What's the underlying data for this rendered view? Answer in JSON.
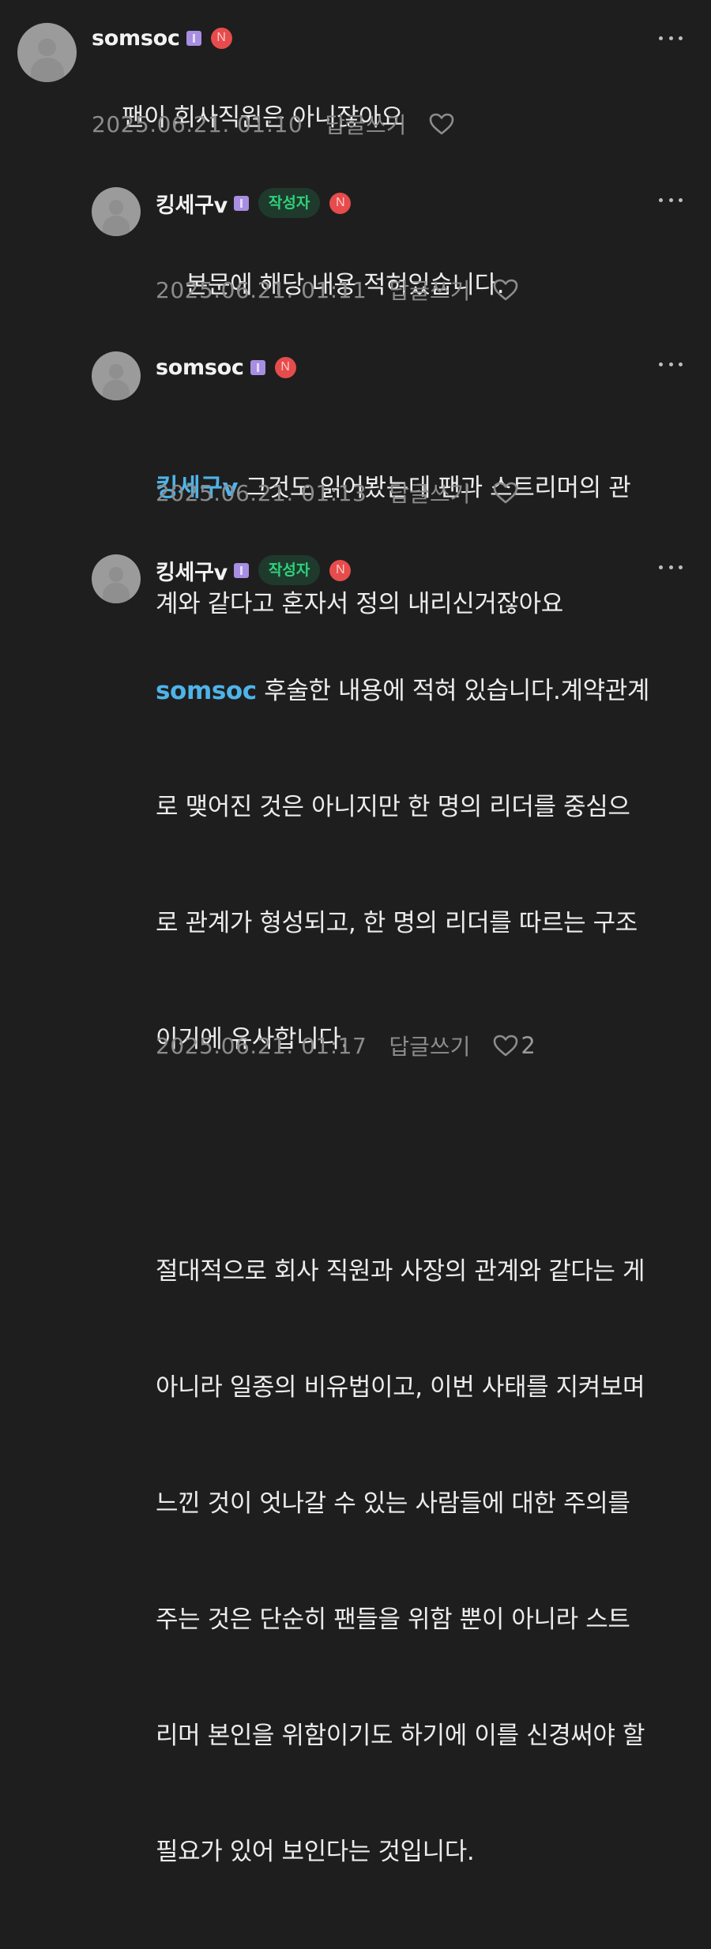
{
  "comments": [
    {
      "author": "somsoc",
      "is_author": false,
      "n_badge": "N",
      "text": "팬이 회사직원은 아니잖아요",
      "mention": "",
      "date": "2025.06.21. 01:10",
      "reply_label": "답글쓰기",
      "likes": ""
    },
    {
      "author": "킹세구v",
      "is_author": true,
      "author_badge": "작성자",
      "n_badge": "N",
      "text": "본문에 해당 내용 적혀있습니다.",
      "mention": "",
      "date": "2025.06.21. 01:11",
      "reply_label": "답글쓰기",
      "likes": ""
    },
    {
      "author": "somsoc",
      "is_author": false,
      "n_badge": "N",
      "mention": "킹세구v",
      "text_line1": " 그것도 읽어봤는데 팬과 스트리머의 관",
      "text_line2": "계와 같다고 혼자서 정의 내리신거잖아요",
      "date": "2025.06.21. 01:13",
      "reply_label": "답글쓰기",
      "likes": ""
    },
    {
      "author": "킹세구v",
      "is_author": true,
      "author_badge": "작성자",
      "n_badge": "N",
      "mention": "somsoc",
      "lines": [
        " 후술한 내용에 적혀 있습니다.계약관계",
        "로 맺어진 것은 아니지만 한 명의 리더를 중심으",
        "로 관계가 형성되고, 한 명의 리더를 따르는 구조",
        "이기에 유사합니다.",
        "",
        "절대적으로 회사 직원과 사장의 관계와 같다는 게",
        "아니라 일종의 비유법이고, 이번 사태를 지켜보며",
        "느낀 것이 엇나갈 수 있는 사람들에 대한 주의를",
        "주는 것은 단순히 팬들을 위함 뿐이 아니라 스트",
        "리머 본인을 위함이기도 하기에 이를 신경써야 할",
        "필요가 있어 보인다는 것입니다."
      ],
      "date": "2025.06.21. 01:17",
      "reply_label": "답글쓰기",
      "likes": "2"
    }
  ],
  "colors": {
    "background": "#1e1e1f",
    "mention": "#4fb3e8",
    "author_badge_text": "#2ed27a",
    "n_badge": "#e74c4c",
    "meta": "#8c8c8c"
  },
  "icons": [
    "avatar-icon",
    "level-icon",
    "n-badge-icon",
    "more-icon",
    "heart-icon"
  ]
}
